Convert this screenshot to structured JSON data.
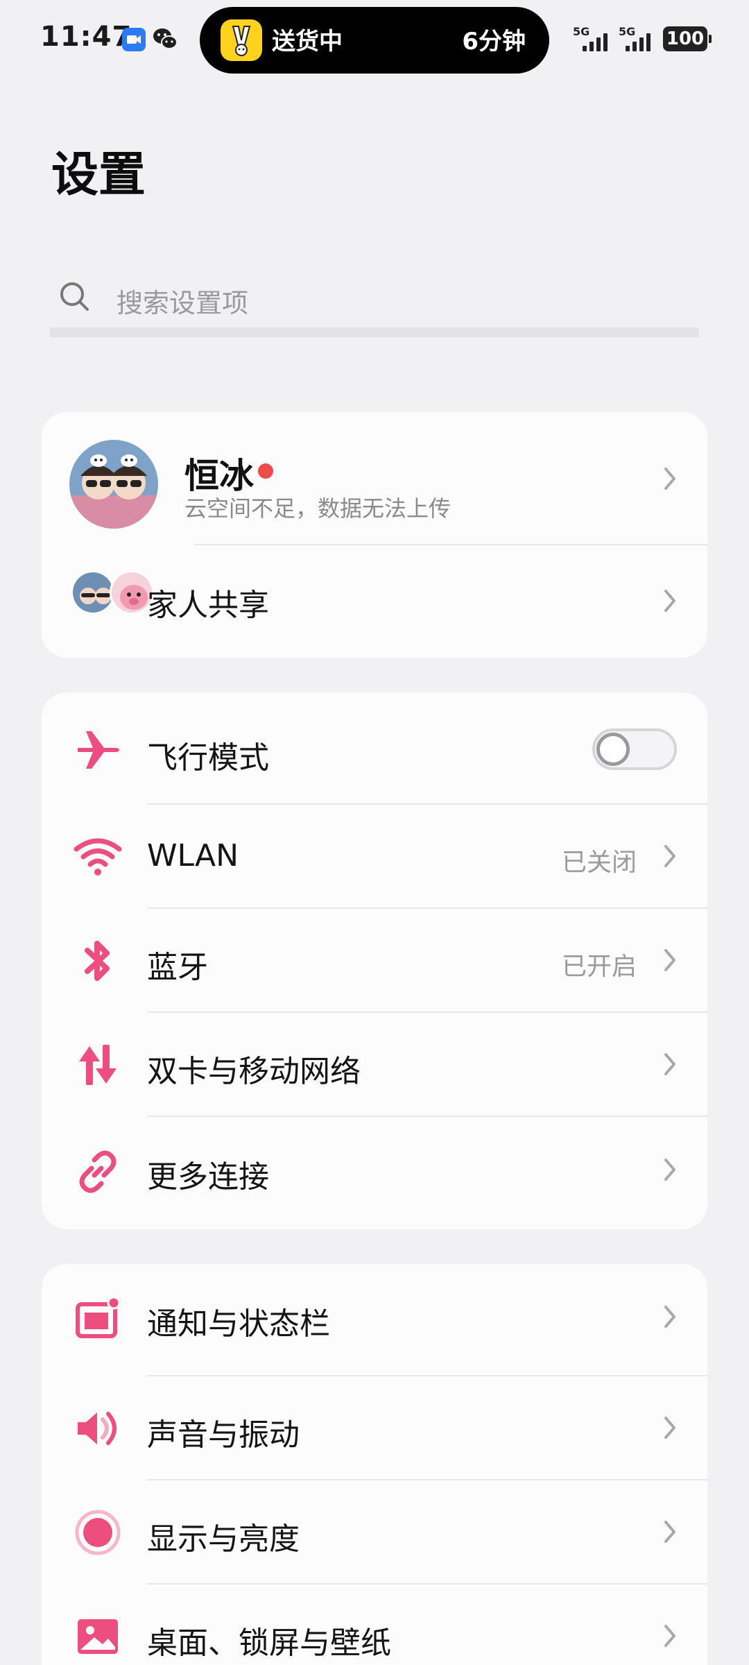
{
  "status_bar": {
    "time": "11:47",
    "live_activity_text": "送货中",
    "live_activity_eta": "6分钟",
    "sim1_network": "5G",
    "sim2_network": "5G",
    "battery": "100"
  },
  "page": {
    "title": "设置"
  },
  "search": {
    "placeholder": "搜索设置项"
  },
  "account": {
    "name": "恒冰",
    "subtitle": "云空间不足，数据无法上传",
    "family_label": "家人共享"
  },
  "connectivity": [
    {
      "label": "飞行模式",
      "icon": "airplane-icon",
      "toggle_on": false
    },
    {
      "label": "WLAN",
      "icon": "wifi-icon",
      "value": "已关闭"
    },
    {
      "label": "蓝牙",
      "icon": "bluetooth-icon",
      "value": "已开启"
    },
    {
      "label": "双卡与移动网络",
      "icon": "mobile-data-icon"
    },
    {
      "label": "更多连接",
      "icon": "link-icon"
    }
  ],
  "personalization": [
    {
      "label": "通知与状态栏",
      "icon": "notification-icon"
    },
    {
      "label": "声音与振动",
      "icon": "sound-icon"
    },
    {
      "label": "显示与亮度",
      "icon": "display-icon"
    },
    {
      "label": "桌面、锁屏与壁纸",
      "icon": "wallpaper-icon"
    }
  ],
  "colors": {
    "accent": "#EC4F7F",
    "background": "#F1F1F4",
    "card": "#FCFCFD"
  }
}
